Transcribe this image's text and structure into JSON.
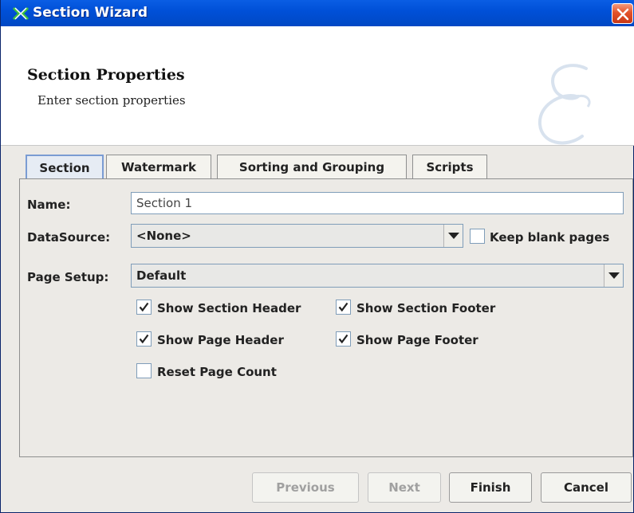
{
  "window": {
    "title": "Section Wizard",
    "title_icon": "wizard-app-icon",
    "close_icon": "close-icon"
  },
  "banner": {
    "title": "Section Properties",
    "subtitle": "Enter section properties",
    "logo": "script-e-logo"
  },
  "tabs": [
    {
      "label": "Section",
      "active": true
    },
    {
      "label": "Watermark",
      "active": false
    },
    {
      "label": "Sorting and Grouping",
      "active": false
    },
    {
      "label": "Scripts",
      "active": false
    }
  ],
  "form": {
    "name_label": "Name:",
    "name_value": "Section 1",
    "datasource_label": "DataSource:",
    "datasource_value": "<None>",
    "keep_blank_label": "Keep blank pages",
    "keep_blank_checked": false,
    "page_setup_label": "Page Setup:",
    "page_setup_value": "Default",
    "checks": {
      "show_section_header": {
        "label": "Show Section Header",
        "checked": true
      },
      "show_section_footer": {
        "label": "Show Section Footer",
        "checked": true
      },
      "show_page_header": {
        "label": "Show Page Header",
        "checked": true
      },
      "show_page_footer": {
        "label": "Show Page Footer",
        "checked": true
      },
      "reset_page_count": {
        "label": "Reset Page Count",
        "checked": false
      }
    }
  },
  "buttons": {
    "previous": {
      "label": "Previous",
      "enabled": false
    },
    "next": {
      "label": "Next",
      "enabled": false
    },
    "finish": {
      "label": "Finish",
      "enabled": true
    },
    "cancel": {
      "label": "Cancel",
      "enabled": true
    }
  },
  "colors": {
    "titlebar": "#0050d8",
    "dialog_bg": "#eceae6",
    "active_tab_border": "#7a9cd3",
    "close_button": "#e3522a"
  }
}
